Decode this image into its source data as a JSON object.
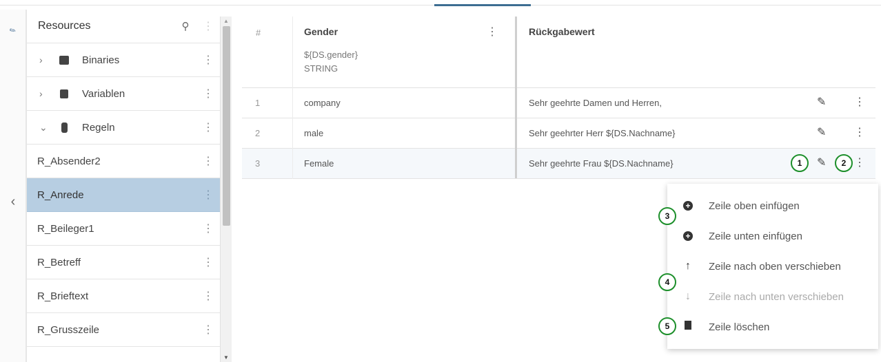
{
  "sidebar": {
    "title": "Resources",
    "folders": [
      {
        "label": "Binaries",
        "icon": "image-icon"
      },
      {
        "label": "Variablen",
        "icon": "variable-icon"
      },
      {
        "label": "Regeln",
        "icon": "database-icon"
      }
    ],
    "items": [
      "R_Absender2",
      "R_Anrede",
      "R_Beileger1",
      "R_Betreff",
      "R_Brieftext",
      "R_Grusszeile"
    ],
    "active_item": "R_Anrede"
  },
  "table": {
    "hash_header": "#",
    "col1": {
      "title": "Gender",
      "expr": "${DS.gender}",
      "type": "STRING"
    },
    "col2": {
      "title": "Rückgabewert"
    },
    "rows": [
      {
        "num": "1",
        "gender": "company",
        "value": "Sehr geehrte Damen und Herren,"
      },
      {
        "num": "2",
        "gender": "male",
        "value": "Sehr geehrter Herr ${DS.Nachname}"
      },
      {
        "num": "3",
        "gender": "Female",
        "value": "Sehr geehrte Frau ${DS.Nachname}"
      }
    ]
  },
  "context_menu": {
    "items": [
      {
        "label": "Zeile oben einfügen",
        "icon": "plus-circle-icon",
        "disabled": false
      },
      {
        "label": "Zeile unten einfügen",
        "icon": "plus-circle-icon",
        "disabled": false
      },
      {
        "label": "Zeile nach oben verschieben",
        "icon": "arrow-up-icon",
        "disabled": false
      },
      {
        "label": "Zeile nach unten verschieben",
        "icon": "arrow-down-icon",
        "disabled": true
      },
      {
        "label": "Zeile löschen",
        "icon": "trash-icon",
        "disabled": false
      }
    ]
  },
  "callouts": [
    "1",
    "2",
    "3",
    "4",
    "5"
  ],
  "colors": {
    "active_row": "#b7cee2",
    "callout_ring": "#1d8f2b",
    "tab_indicator": "#3d6d92"
  }
}
